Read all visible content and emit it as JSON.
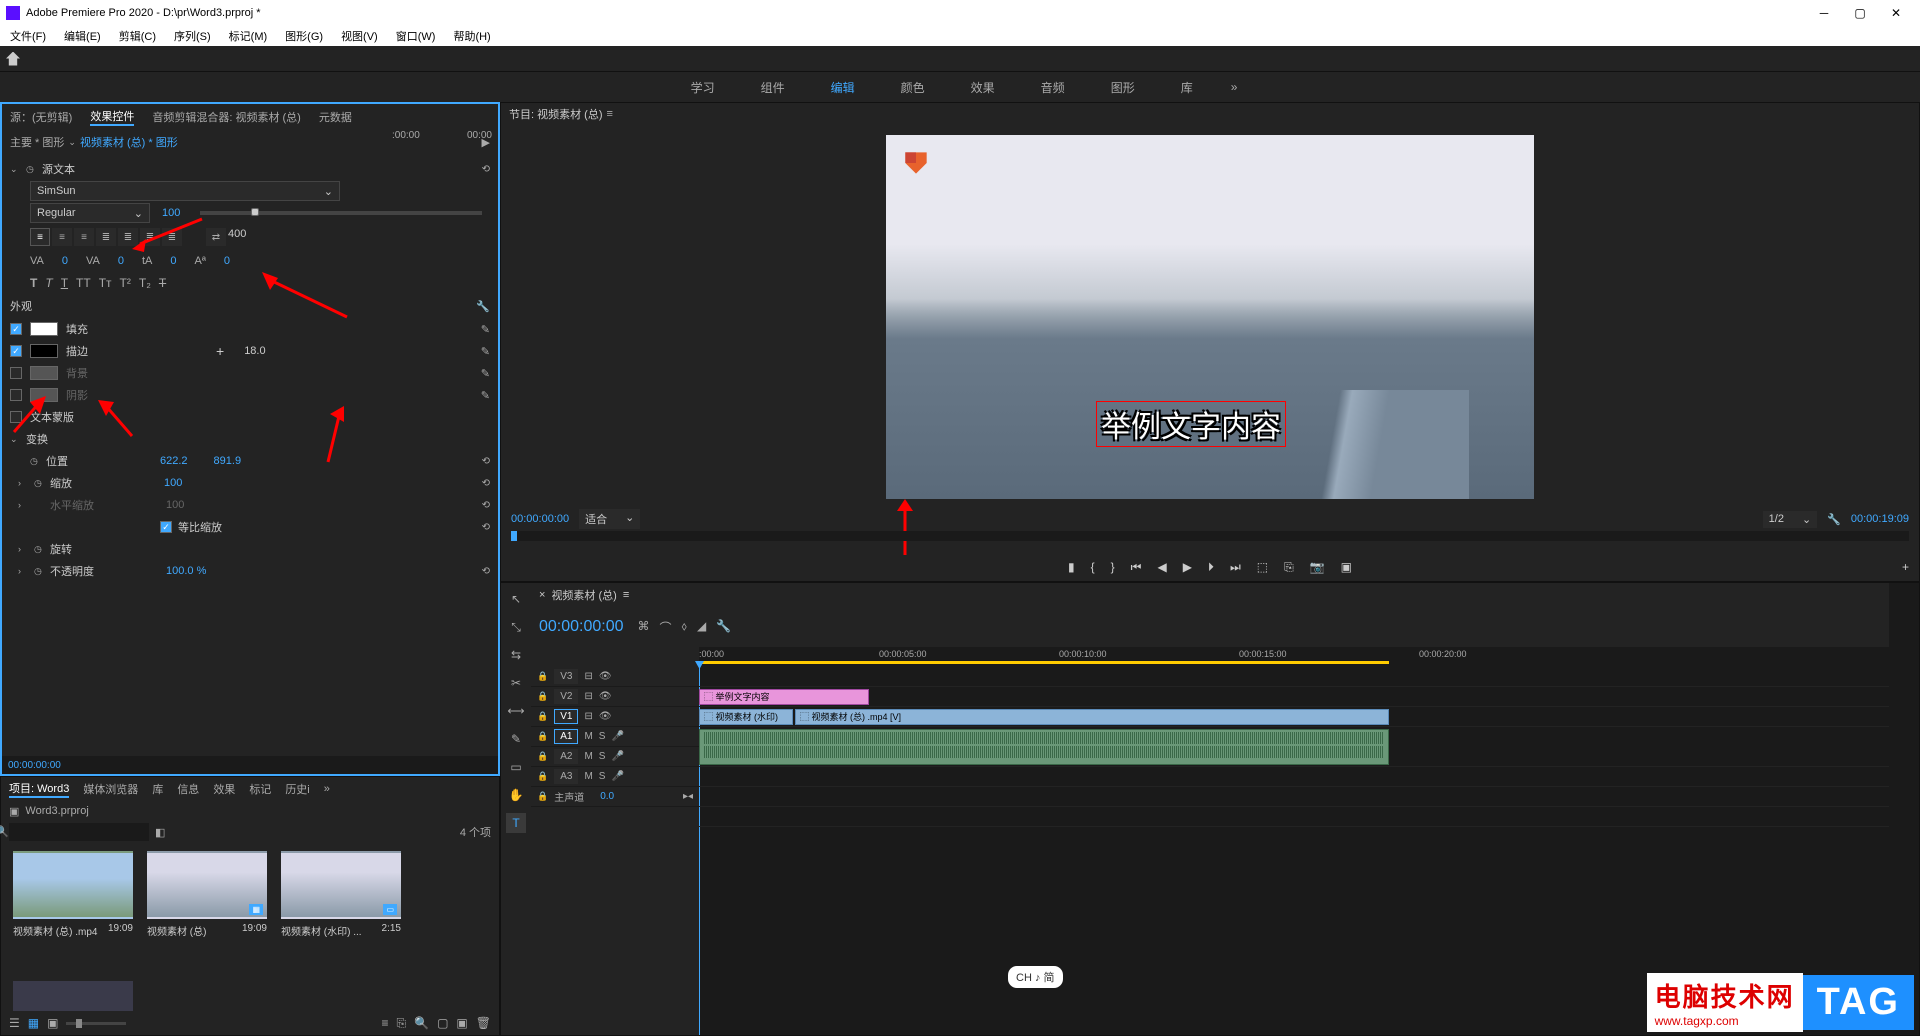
{
  "title": "Adobe Premiere Pro 2020 - D:\\pr\\Word3.prproj *",
  "menus": [
    "文件(F)",
    "编辑(E)",
    "剪辑(C)",
    "序列(S)",
    "标记(M)",
    "图形(G)",
    "视图(V)",
    "窗口(W)",
    "帮助(H)"
  ],
  "workspaces": {
    "items": [
      "学习",
      "组件",
      "编辑",
      "颜色",
      "效果",
      "音频",
      "图形",
      "库"
    ],
    "active": "编辑"
  },
  "source_tabs": {
    "items": [
      "源：(无剪辑)",
      "效果控件",
      "音频剪辑混合器: 视频素材 (总)",
      "元数据"
    ],
    "active": "效果控件"
  },
  "ec": {
    "breadcrumb_main": "主要 * 图形",
    "breadcrumb_seq": "视频素材 (总) * 图形",
    "tl_start": ":00:00",
    "tl_end": "00:00",
    "source_text": "源文本",
    "font": "SimSun",
    "style": "Regular",
    "size": "100",
    "tracking": "400",
    "kerning": "0",
    "leading": "0",
    "baseline": "0",
    "tsume": "0",
    "appearance": "外观",
    "fill": {
      "label": "填充",
      "on": true
    },
    "stroke": {
      "label": "描边",
      "on": true,
      "value": "18.0"
    },
    "bg": {
      "label": "背景",
      "on": false
    },
    "shadow": {
      "label": "阴影",
      "on": false
    },
    "mask": "文本蒙版",
    "transform": "变换",
    "pos": {
      "label": "位置",
      "x": "622.2",
      "y": "891.9"
    },
    "scale": {
      "label": "缩放",
      "v": "100"
    },
    "hscale": {
      "label": "水平缩放",
      "v": "100"
    },
    "uniform": "等比缩放",
    "rotate": {
      "label": "旋转"
    },
    "opacity": {
      "label": "不透明度",
      "v": "100.0 %"
    },
    "footer_tc": "00:00:00:00"
  },
  "project": {
    "tabs": [
      "项目: Word3",
      "媒体浏览器",
      "库",
      "信息",
      "效果",
      "标记",
      "历史i"
    ],
    "active": "项目: Word3",
    "file": "Word3.prproj",
    "count": "4 个项",
    "items": [
      {
        "name": "视频素材 (总) .mp4",
        "dur": "19:09"
      },
      {
        "name": "视频素材 (总)",
        "dur": "19:09"
      },
      {
        "name": "视频素材 (水印) ...",
        "dur": "2:15"
      }
    ]
  },
  "program": {
    "title": "节目: 视频素材 (总)",
    "text": "举例文字内容",
    "tc": "00:00:00:00",
    "fit": "适合",
    "zoom": "1/2",
    "dur": "00:00:19:09"
  },
  "timeline": {
    "title": "视频素材 (总)",
    "tc": "00:00:00:00",
    "ticks": [
      ":00:00",
      "00:00:05:00",
      "00:00:10:00",
      "00:00:15:00",
      "00:00:20:00"
    ],
    "tracks": {
      "v3": "V3",
      "v2": "V2",
      "v1": "V1",
      "a1": "A1",
      "a2": "A2",
      "a3": "A3",
      "master": "主声道",
      "master_val": "0.0"
    },
    "clips": {
      "text": "举例文字内容",
      "video1": "视频素材 (水印)",
      "video2": "视频素材 (总) .mp4 [V]"
    }
  },
  "ime": "CH ♪ 简",
  "overlay": {
    "cn": "电脑技术网",
    "url": "www.tagxp.com",
    "tag": "TAG"
  }
}
